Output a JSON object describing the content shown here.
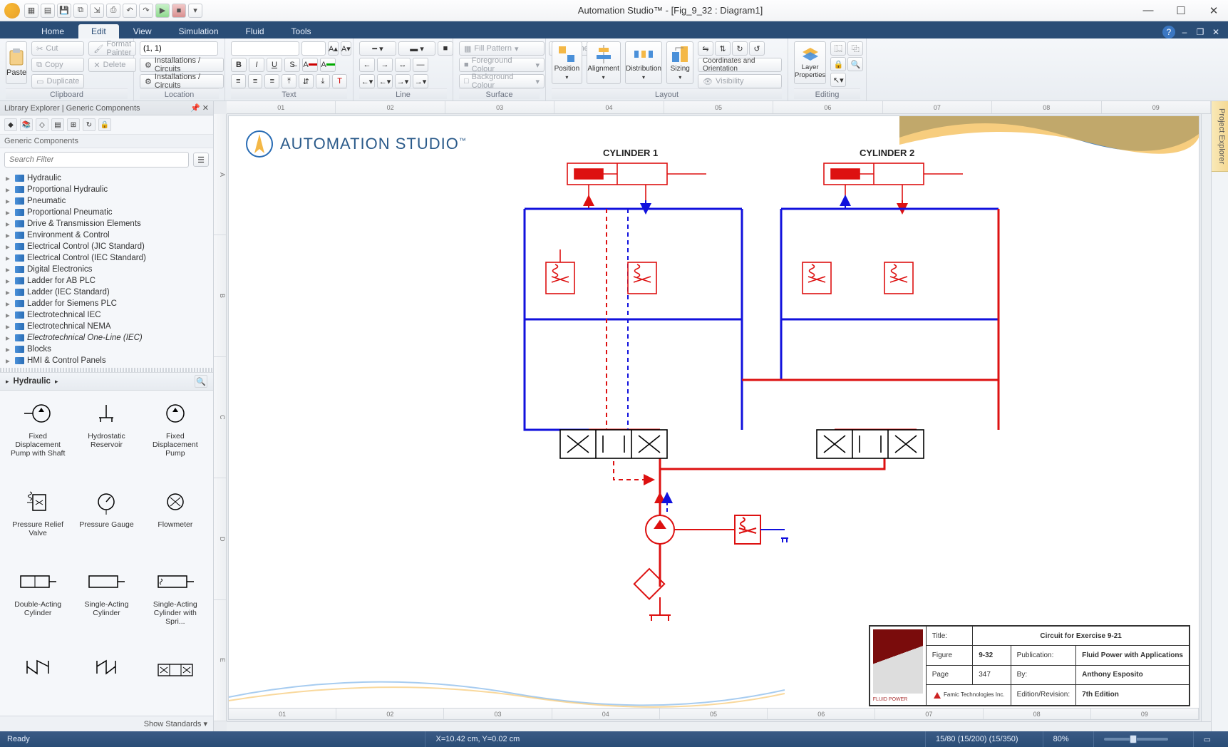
{
  "app": {
    "title": "Automation Studio™   - [Fig_9_32 : Diagram1]"
  },
  "qat_icons": [
    "new",
    "open",
    "save",
    "saveall",
    "export",
    "print",
    "undo",
    "redo",
    "play",
    "stop"
  ],
  "tabs": [
    "Home",
    "Edit",
    "View",
    "Simulation",
    "Fluid",
    "Tools"
  ],
  "active_tab": "Edit",
  "ribbon": {
    "clipboard": {
      "paste": "Paste",
      "cut": "Cut",
      "copy": "Copy",
      "delete": "Delete",
      "duplicate": "Duplicate",
      "format_painter": "Format Painter",
      "label": "Clipboard"
    },
    "location": {
      "coord": "(1, 1)",
      "inst1": "Installations / Circuits",
      "inst2": "Installations / Circuits",
      "label": "Location"
    },
    "text": {
      "label": "Text"
    },
    "line": {
      "label": "Line"
    },
    "surface": {
      "fill": "Fill Pattern",
      "fg": "Foreground Colour",
      "bg": "Background Colour",
      "outline": "Outline",
      "label": "Surface"
    },
    "layout": {
      "position": "Position",
      "alignment": "Alignment",
      "distribution": "Distribution",
      "sizing": "Sizing",
      "coords": "Coordinates and Orientation",
      "visibility": "Visibility",
      "label": "Layout"
    },
    "editing": {
      "layerprops": "Layer Properties",
      "label": "Editing"
    }
  },
  "library": {
    "panel_title": "Library Explorer | Generic Components",
    "subtitle": "Generic Components",
    "search_placeholder": "Search Filter",
    "categories": [
      "Hydraulic",
      "Proportional Hydraulic",
      "Pneumatic",
      "Proportional Pneumatic",
      "Drive & Transmission Elements",
      "Environment & Control",
      "Electrical Control (JIC Standard)",
      "Electrical Control (IEC Standard)",
      "Digital Electronics",
      "Ladder for AB PLC",
      "Ladder (IEC Standard)",
      "Ladder for Siemens PLC",
      "Electrotechnical IEC",
      "Electrotechnical NEMA",
      "Electrotechnical One-Line (IEC)",
      "Blocks",
      "HMI & Control Panels"
    ],
    "breadcrumb": "Hydraulic",
    "components": [
      "Fixed Displacement Pump with Shaft",
      "Hydrostatic Reservoir",
      "Fixed Displacement Pump",
      "Pressure Relief Valve",
      "Pressure Gauge",
      "Flowmeter",
      "Double-Acting Cylinder",
      "Single-Acting Cylinder",
      "Single-Acting Cylinder with Spri..."
    ],
    "show_standards": "Show Standards"
  },
  "canvas": {
    "logo_text": "AUTOMATION STUDIO",
    "tm": "™",
    "cyl1": "CYLINDER 1",
    "cyl2": "CYLINDER 2",
    "ruler_h": [
      "01",
      "02",
      "03",
      "04",
      "05",
      "06",
      "07",
      "08",
      "09"
    ],
    "ruler_v": [
      "A",
      "B",
      "C",
      "D",
      "E"
    ]
  },
  "titleblock": {
    "title_k": "Title:",
    "title_v": "Circuit for Exercise 9-21",
    "fig_k": "Figure",
    "fig_v": "9-32",
    "pub_k": "Publication:",
    "pub_v": "Fluid Power with Applications",
    "page_k": "Page",
    "page_v": "347",
    "by_k": "By:",
    "by_v": "Anthony Esposito",
    "ed_k": "Edition/Revision:",
    "ed_v": "7th Edition",
    "famic": "Famic Technologies Inc."
  },
  "right_panel": "Project Explorer",
  "status": {
    "ready": "Ready",
    "coords": "X=10.42 cm, Y=0.02 cm",
    "views": "15/80 (15/200) (15/350)",
    "zoom": "80%"
  }
}
